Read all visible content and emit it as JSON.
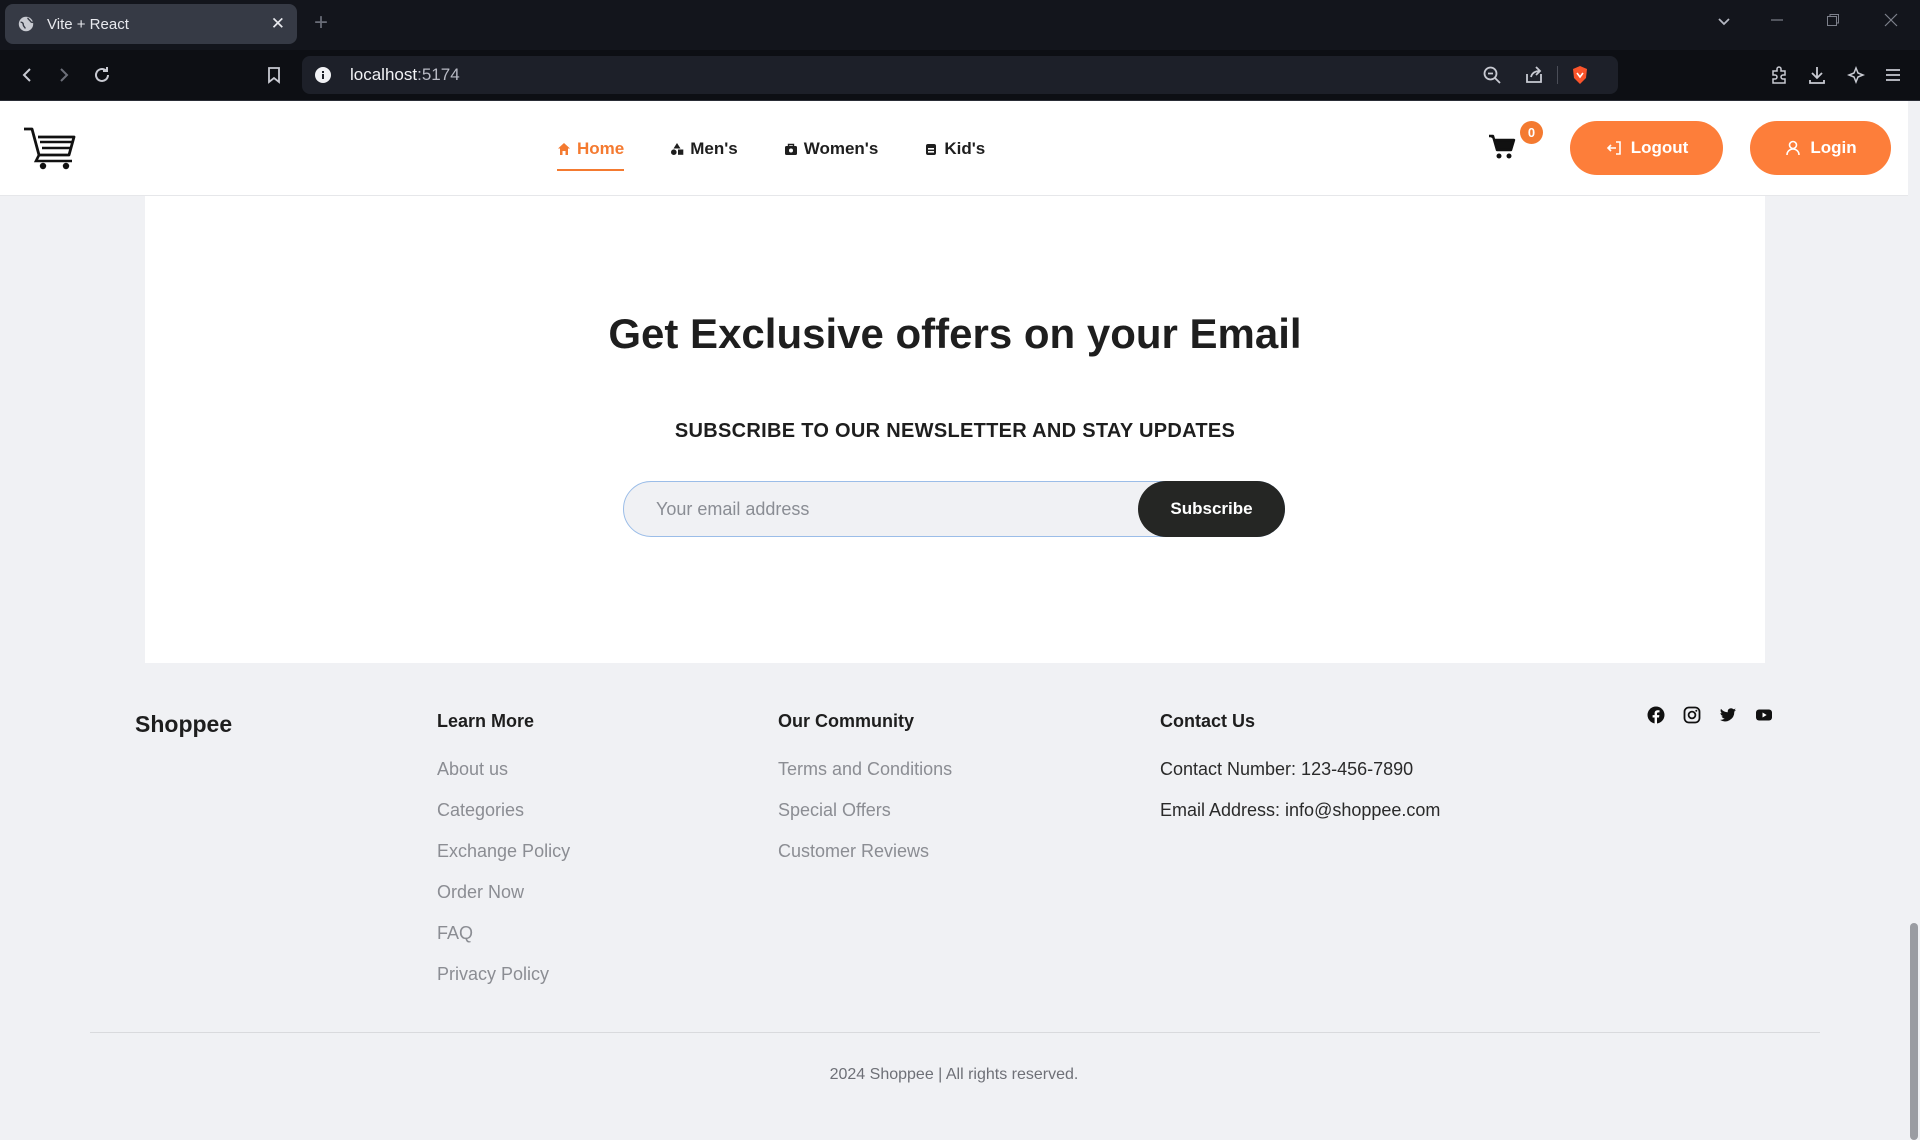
{
  "browser": {
    "tab_title": "Vite + React",
    "url_host": "localhost",
    "url_port": ":5174"
  },
  "header": {
    "nav": [
      {
        "label": "Home",
        "active": true
      },
      {
        "label": "Men's",
        "active": false
      },
      {
        "label": "Women's",
        "active": false
      },
      {
        "label": "Kid's",
        "active": false
      }
    ],
    "cart_count": "0",
    "logout_label": "Logout",
    "login_label": "Login",
    "accent_color": "#fd7e3a"
  },
  "newsletter": {
    "title": "Get Exclusive offers on your Email",
    "subtitle": "SUBSCRIBE TO OUR NEWSLETTER AND STAY UPDATES",
    "input_placeholder": "Your email address",
    "button_label": "Subscribe"
  },
  "footer": {
    "brand": "Shoppee",
    "learn_more": {
      "heading": "Learn More",
      "links": [
        "About us",
        "Categories",
        "Exchange Policy",
        "Order Now",
        "FAQ",
        "Privacy Policy"
      ]
    },
    "community": {
      "heading": "Our Community",
      "links": [
        "Terms and Conditions",
        "Special Offers",
        "Customer Reviews"
      ]
    },
    "contact": {
      "heading": "Contact Us",
      "phone": "Contact Number: 123-456-7890",
      "email": "Email Address: info@shoppee.com"
    },
    "social_icons": [
      "facebook-icon",
      "instagram-icon",
      "twitter-icon",
      "youtube-icon"
    ],
    "copyright": "2024 Shoppee | All rights reserved."
  }
}
